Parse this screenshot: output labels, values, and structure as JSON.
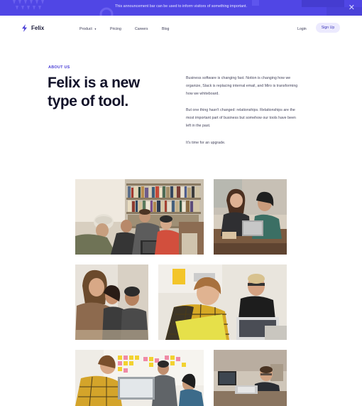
{
  "announcement": {
    "text": "This announcement bar can be used to inform visitors of something important.",
    "close_icon": "close-icon",
    "background": "#5046e5"
  },
  "nav": {
    "brand": "Felix",
    "logo_icon": "bolt-icon",
    "links": [
      {
        "label": "Product",
        "has_dropdown": true
      },
      {
        "label": "Pricing"
      },
      {
        "label": "Careers"
      },
      {
        "label": "Blog"
      }
    ],
    "login": "Login",
    "signup": "Sign Up"
  },
  "about": {
    "eyebrow": "ABOUT US",
    "headline_line1": "Felix is a new",
    "headline_line2": "type of tool.",
    "paragraphs": [
      "Business software is changing fast. Notion is changing how we organize, Slack is replacing internal email, and Miro is transforming how we whiteboard.",
      "But one thing hasn't changed: relationships. Relationships are the most important part of business but somehow our tools have been left in the past.",
      "It's time for an upgrade."
    ]
  },
  "colors": {
    "accent": "#4a3fd6",
    "heading": "#111129",
    "signup_bg": "#eceafe"
  }
}
